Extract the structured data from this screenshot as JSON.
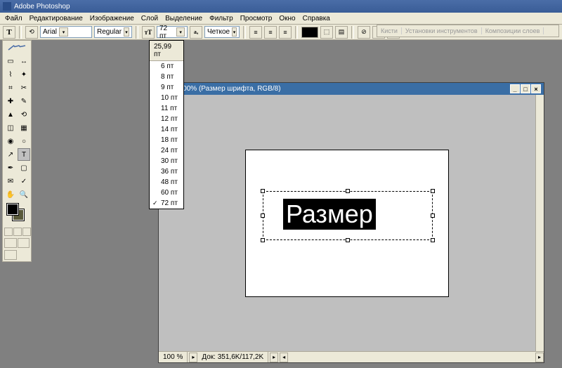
{
  "app": {
    "title": "Adobe Photoshop"
  },
  "menu": [
    "Файл",
    "Редактирование",
    "Изображение",
    "Слой",
    "Выделение",
    "Фильтр",
    "Просмотр",
    "Окно",
    "Справка"
  ],
  "options": {
    "font": "Arial",
    "style": "Regular",
    "size": "72 пт",
    "aa": "Четкое"
  },
  "size_dropdown": {
    "current": "25,99 пт",
    "items": [
      "6 пт",
      "8 пт",
      "9 пт",
      "10 пт",
      "11 пт",
      "12 пт",
      "14 пт",
      "18 пт",
      "24 пт",
      "30 пт",
      "36 пт",
      "48 пт",
      "60 пт",
      "72 пт"
    ],
    "checked": "72 пт"
  },
  "document": {
    "title": "-1 @ 100% (Размер шрифта, RGB/8)",
    "zoom": "100 %",
    "docinfo": "Док: 351,6K/117,2K",
    "canvas_text": "Размер"
  },
  "palette_tabs": [
    "Кисти",
    "Установки инструментов",
    "Композиции слоев"
  ]
}
